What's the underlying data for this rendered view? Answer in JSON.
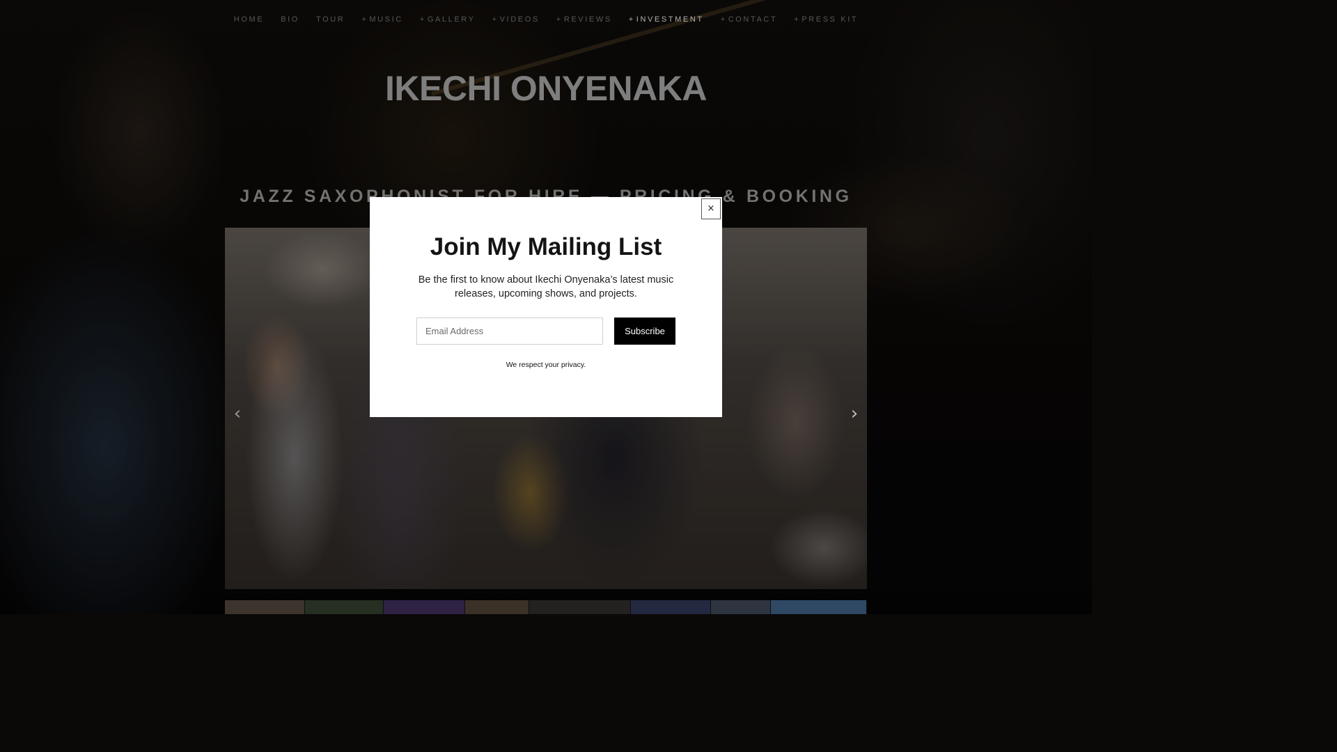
{
  "nav": {
    "items": [
      {
        "prefix": "",
        "label": "HOME",
        "active": false
      },
      {
        "prefix": "",
        "label": "BIO",
        "active": false
      },
      {
        "prefix": "",
        "label": "TOUR",
        "active": false
      },
      {
        "prefix": "+",
        "label": "MUSIC",
        "active": false
      },
      {
        "prefix": "+",
        "label": "GALLERY",
        "active": false
      },
      {
        "prefix": "+",
        "label": "VIDEOS",
        "active": false
      },
      {
        "prefix": "+",
        "label": "REVIEWS",
        "active": false
      },
      {
        "prefix": "+",
        "label": "INVESTMENT",
        "active": true
      },
      {
        "prefix": "+",
        "label": "CONTACT",
        "active": false
      },
      {
        "prefix": "+",
        "label": "PRESS KIT",
        "active": false
      }
    ]
  },
  "site": {
    "title": "IKECHI ONYENAKA"
  },
  "page": {
    "heading": "JAZZ SAXOPHONIST FOR HIRE — PRICING & BOOKING"
  },
  "slideshow": {
    "prev_icon": "chevron-left-icon",
    "next_icon": "chevron-right-icon",
    "prev_glyph": "‹",
    "next_glyph": "›",
    "thumbnail_colors": [
      "#4a4038",
      "#2e3a2a",
      "#3a2a55",
      "#4a3c30",
      "#2c2a28",
      "#2a3350",
      "#3a4050",
      "#3a5a7a"
    ]
  },
  "modal": {
    "close_glyph": "×",
    "title": "Join My Mailing List",
    "description": "Be the first to know about Ikechi Onyenaka’s latest music releases, upcoming shows, and projects.",
    "email_placeholder": "Email Address",
    "email_value": "",
    "subscribe_label": "Subscribe",
    "privacy_text": "We respect your privacy."
  },
  "colors": {
    "nav_inactive": "#6c6c6c",
    "nav_active": "#d8d8d8",
    "button_bg": "#000000",
    "modal_bg": "#ffffff"
  }
}
